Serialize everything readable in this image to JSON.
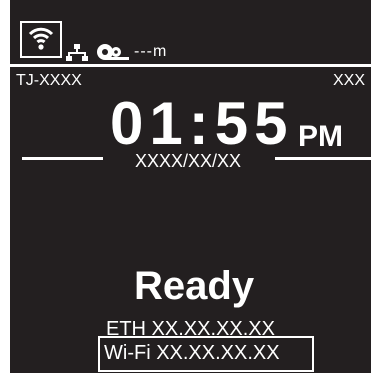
{
  "status_bar": {
    "wifi_icon": "wifi-signal-icon",
    "network_icon": "wired-network-icon",
    "tape_icon": "tape-reel-icon",
    "remaining_value": "---m"
  },
  "header": {
    "model_name": "TJ-XXXX",
    "right_code": "XXX"
  },
  "clock": {
    "time": "01:55",
    "meridiem": "PM",
    "date": "XXXX/XX/XX"
  },
  "status": {
    "text": "Ready"
  },
  "network": {
    "eth_label": "ETH XX.XX.XX.XX",
    "wifi_label": "Wi-Fi XX.XX.XX.XX"
  },
  "colors": {
    "background": "#231f20",
    "foreground": "#ffffff"
  }
}
